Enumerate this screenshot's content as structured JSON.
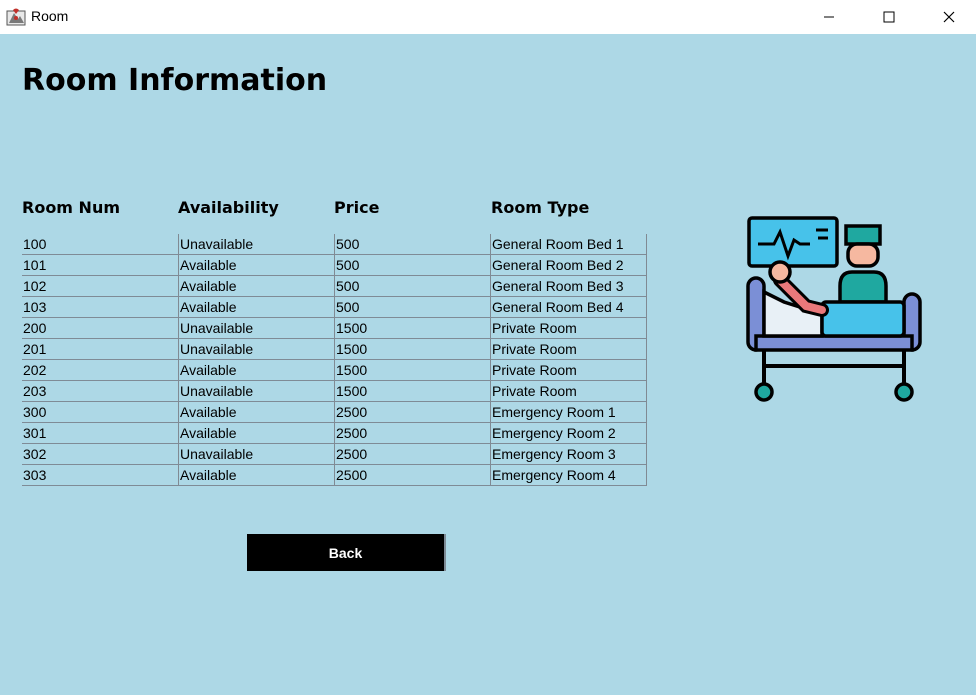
{
  "window": {
    "title": "Room",
    "icon": "java-app-icon",
    "controls": [
      "minimize-icon",
      "maximize-icon",
      "close-icon"
    ]
  },
  "page": {
    "title": "Room Information"
  },
  "table": {
    "columns": [
      "Room Num",
      "Availability",
      "Price",
      "Room Type"
    ],
    "rows": [
      [
        "100",
        "Unavailable",
        "500",
        "General Room Bed 1"
      ],
      [
        "101",
        "Available",
        "500",
        "General Room Bed 2"
      ],
      [
        "102",
        "Available",
        "500",
        "General Room Bed 3"
      ],
      [
        "103",
        "Available",
        "500",
        "General Room Bed 4"
      ],
      [
        "200",
        "Unavailable",
        "1500",
        "Private Room"
      ],
      [
        "201",
        "Unavailable",
        "1500",
        "Private Room"
      ],
      [
        "202",
        "Available",
        "1500",
        "Private Room"
      ],
      [
        "203",
        "Unavailable",
        "1500",
        "Private Room"
      ],
      [
        "300",
        "Available",
        "2500",
        "Emergency Room 1"
      ],
      [
        "301",
        "Available",
        "2500",
        "Emergency Room 2"
      ],
      [
        "302",
        "Unavailable",
        "2500",
        "Emergency Room 3"
      ],
      [
        "303",
        "Available",
        "2500",
        "Emergency Room 4"
      ]
    ]
  },
  "actions": {
    "back_label": "Back"
  },
  "illustration": {
    "icon": "hospital-patient-bed-icon"
  },
  "colors": {
    "background": "#add8e6",
    "button": "#000000",
    "button_text": "#ffffff"
  }
}
